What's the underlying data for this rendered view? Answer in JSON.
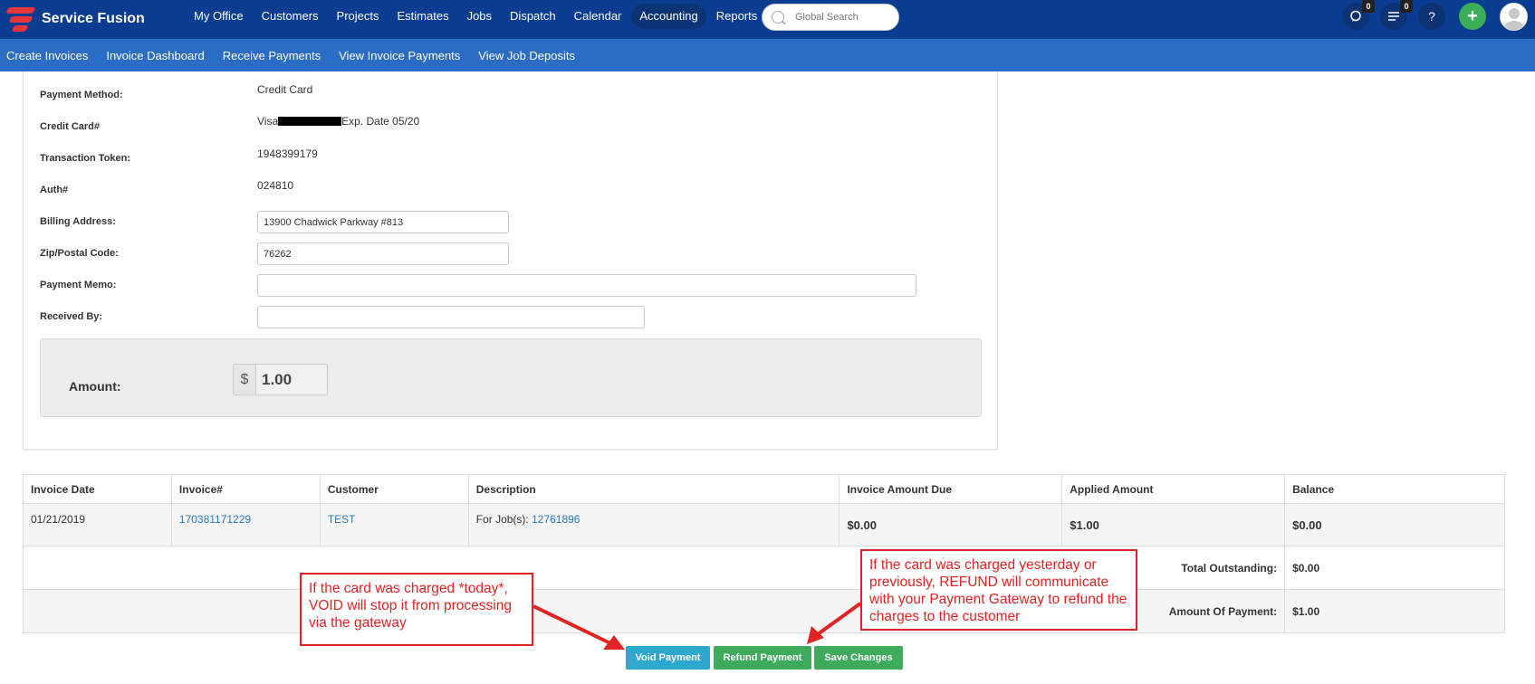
{
  "brand": {
    "name": "Service Fusion"
  },
  "nav": {
    "items": [
      "My Office",
      "Customers",
      "Projects",
      "Estimates",
      "Jobs",
      "Dispatch",
      "Calendar",
      "Accounting",
      "Reports"
    ],
    "active": "Accounting"
  },
  "search": {
    "placeholder": "Global Search"
  },
  "header_icons": {
    "chat_count": "0",
    "notifications_count": "0",
    "help": "?",
    "add": "+"
  },
  "subnav": {
    "items": [
      "Create Invoices",
      "Invoice Dashboard",
      "Receive Payments",
      "View Invoice Payments",
      "View Job Deposits"
    ],
    "active": "View Invoice Payments"
  },
  "form": {
    "payment_method_label": "Payment Method:",
    "payment_method_value": "Credit Card",
    "credit_card_label": "Credit Card#",
    "credit_card_prefix": "Visa",
    "credit_card_suffix": "Exp. Date 05/20",
    "transaction_token_label": "Transaction Token:",
    "transaction_token_value": "1948399179",
    "auth_label": "Auth#",
    "auth_value": "024810",
    "billing_address_label": "Billing Address:",
    "billing_address_value": "13900 Chadwick Parkway #813",
    "zip_label": "Zip/Postal Code:",
    "zip_value": "76262",
    "memo_label": "Payment Memo:",
    "memo_value": "",
    "received_by_label": "Received By:",
    "received_by_value": "",
    "amount_label": "Amount:",
    "currency_symbol": "$",
    "amount_value": "1.00"
  },
  "table": {
    "headers": [
      "Invoice Date",
      "Invoice#",
      "Customer",
      "Description",
      "Invoice Amount Due",
      "Applied Amount",
      "Balance"
    ],
    "rows": [
      {
        "invoice_date": "01/21/2019",
        "invoice_no": "170381171229",
        "customer": "TEST",
        "description_prefix": "For Job(s): ",
        "job_no": "12761896",
        "amount_due": "$0.00",
        "applied": "$1.00",
        "balance": "$0.00"
      }
    ],
    "total_outstanding_label": "Total Outstanding:",
    "total_outstanding_value": "$0.00",
    "amount_of_payment_label": "Amount Of Payment:",
    "amount_of_payment_value": "$1.00"
  },
  "buttons": {
    "void": "Void Payment",
    "refund": "Refund Payment",
    "save": "Save Changes"
  },
  "callouts": {
    "void_note": "If the card was charged *today*, VOID will stop it from processing via the gateway",
    "refund_note": "If the card was charged yesterday or previously, REFUND will communicate with your Payment Gateway to refund the charges to the customer"
  },
  "colors": {
    "topbar": "#0a3d91",
    "subnav": "#2b6cc4",
    "void_button": "#2fa8cf",
    "green_button": "#3daa5c",
    "callout_red": "#e02424"
  }
}
